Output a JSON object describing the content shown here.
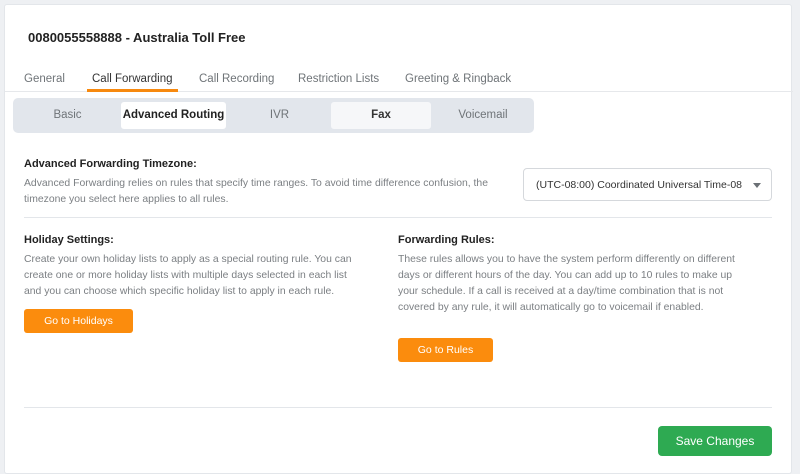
{
  "header": {
    "title": "0080055558888 - Australia Toll Free"
  },
  "tabs": [
    {
      "label": "General"
    },
    {
      "label": "Call Forwarding"
    },
    {
      "label": "Call Recording"
    },
    {
      "label": "Restriction Lists"
    },
    {
      "label": "Greeting & Ringback"
    }
  ],
  "subtabs": [
    {
      "label": "Basic"
    },
    {
      "label": "Advanced Routing"
    },
    {
      "label": "IVR"
    },
    {
      "label": "Fax"
    },
    {
      "label": "Voicemail"
    }
  ],
  "timezone": {
    "label": "Advanced Forwarding Timezone:",
    "description": "Advanced Forwarding relies on rules that specify time ranges. To avoid time difference confusion, the timezone you select here applies to all rules.",
    "selected": "(UTC-08:00) Coordinated Universal Time-08"
  },
  "holiday": {
    "label": "Holiday Settings:",
    "description": "Create your own holiday lists to apply as a special routing rule. You can create one or more holiday lists with multiple days selected in each list and you can choose which specific holiday list to apply in each rule.",
    "button_label": "Go to Holidays"
  },
  "rules": {
    "label": "Forwarding Rules:",
    "description": "These rules allows you to have the system perform differently on different days or different hours of the day. You can add up to 10 rules to make up your schedule. If a call is received at a day/time combination that is not covered by any rule, it will automatically go to voicemail if enabled.",
    "button_label": "Go to Rules"
  },
  "footer": {
    "save_label": "Save Changes"
  },
  "colors": {
    "accent": "#fb8c0d",
    "save": "#2eaa52"
  }
}
